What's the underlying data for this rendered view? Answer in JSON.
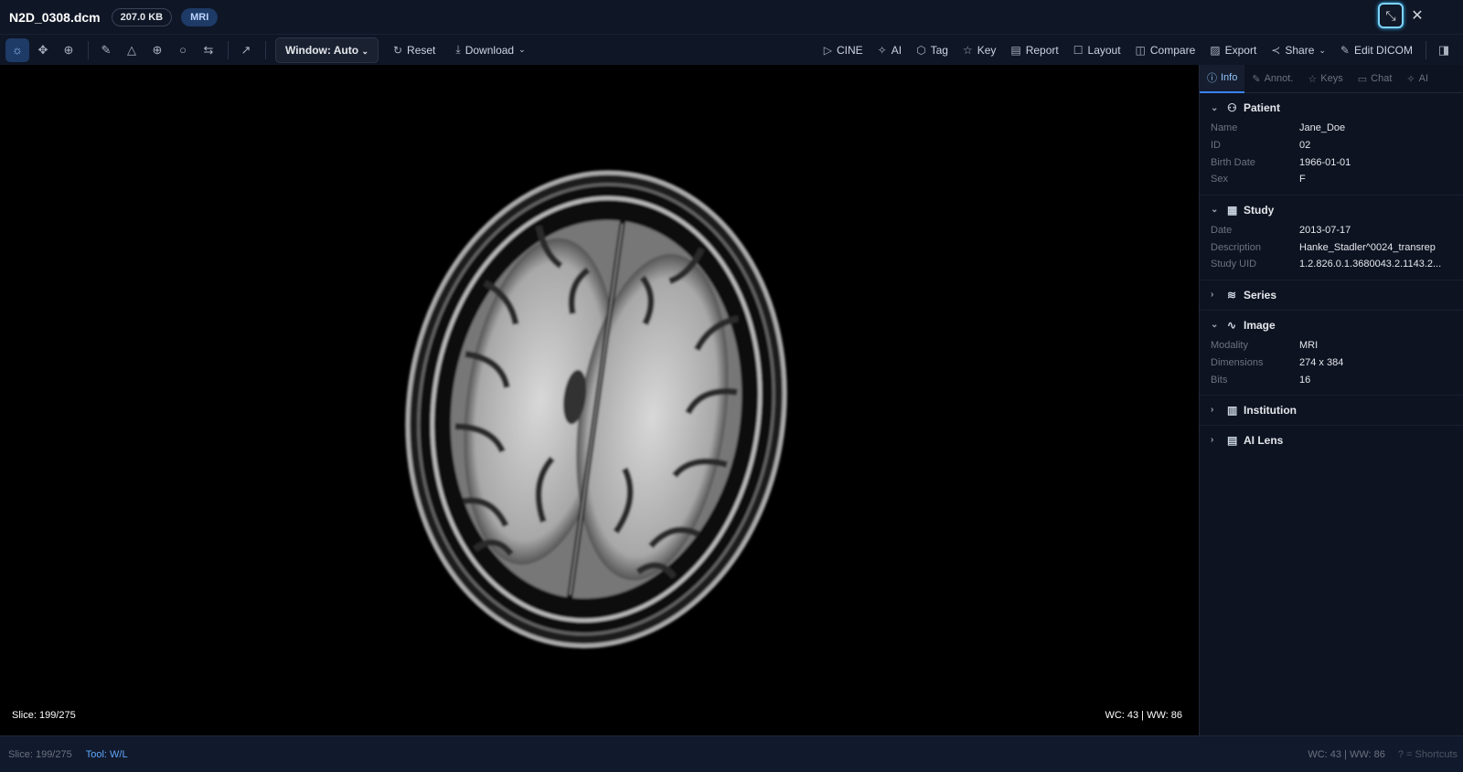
{
  "header": {
    "filename": "N2D_0308.dcm",
    "filesize": "207.0 KB",
    "modality_badge": "MRI",
    "minimize_icon": "collapse-arrows-icon",
    "close_icon": "x-icon"
  },
  "toolbar": {
    "tools": [
      {
        "name": "window-level",
        "icon": "☼"
      },
      {
        "name": "pan",
        "icon": "✥"
      },
      {
        "name": "zoom",
        "icon": "⊕"
      },
      {
        "name": "length",
        "icon": "✎"
      },
      {
        "name": "angle",
        "icon": "△"
      },
      {
        "name": "crosshair",
        "icon": "⊕"
      },
      {
        "name": "ellipse",
        "icon": "○"
      },
      {
        "name": "flip",
        "icon": "⇆"
      },
      {
        "name": "arrow",
        "icon": "↗"
      }
    ],
    "window": "Window: Auto",
    "reset": "Reset",
    "download": "Download",
    "actions": [
      {
        "label": "CINE",
        "icon": "▷"
      },
      {
        "label": "AI",
        "icon": "✧"
      },
      {
        "label": "Tag",
        "icon": "⬡"
      },
      {
        "label": "Key",
        "icon": "☆"
      },
      {
        "label": "Report",
        "icon": "▤"
      },
      {
        "label": "Layout",
        "icon": "☐"
      },
      {
        "label": "Compare",
        "icon": "◫"
      },
      {
        "label": "Export",
        "icon": "▨"
      },
      {
        "label": "Share",
        "icon": "≺"
      },
      {
        "label": "Edit DICOM",
        "icon": "✎"
      }
    ]
  },
  "viewer": {
    "slice": "Slice: 199/275",
    "wcww": "WC: 43 | WW: 86"
  },
  "sidebar": {
    "tabs": [
      {
        "label": "Info",
        "icon": "ⓘ"
      },
      {
        "label": "Annot.",
        "icon": "✎"
      },
      {
        "label": "Keys",
        "icon": "☆"
      },
      {
        "label": "Chat",
        "icon": "▭"
      },
      {
        "label": "AI",
        "icon": "✧"
      }
    ],
    "patient": {
      "title": "Patient",
      "rows": [
        {
          "k": "Name",
          "v": "Jane_Doe"
        },
        {
          "k": "ID",
          "v": "02"
        },
        {
          "k": "Birth Date",
          "v": "1966-01-01"
        },
        {
          "k": "Sex",
          "v": "F"
        }
      ]
    },
    "study": {
      "title": "Study",
      "rows": [
        {
          "k": "Date",
          "v": "2013-07-17"
        },
        {
          "k": "Description",
          "v": "Hanke_Stadler^0024_transrep"
        },
        {
          "k": "Study UID",
          "v": "1.2.826.0.1.3680043.2.1143.2..."
        }
      ]
    },
    "series": {
      "title": "Series"
    },
    "image": {
      "title": "Image",
      "rows": [
        {
          "k": "Modality",
          "v": "MRI"
        },
        {
          "k": "Dimensions",
          "v": "274 x 384"
        },
        {
          "k": "Bits",
          "v": "16"
        }
      ]
    },
    "institution": {
      "title": "Institution"
    },
    "ailens": {
      "title": "AI Lens"
    }
  },
  "status": {
    "slice": "Slice: 199/275",
    "tool": "Tool: W/L",
    "wcww": "WC: 43 | WW: 86",
    "shortcuts": "? = Shortcuts"
  }
}
